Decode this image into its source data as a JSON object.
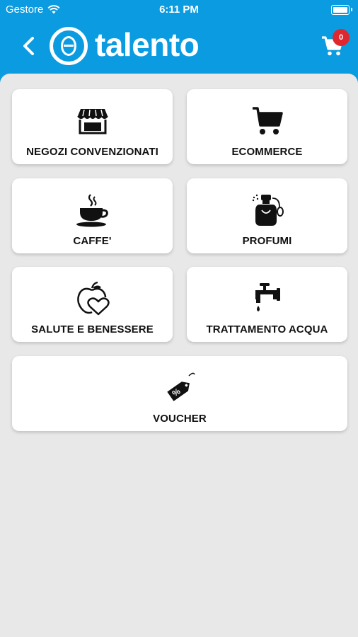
{
  "status": {
    "carrier": "Gestore",
    "time": "6:11 PM"
  },
  "header": {
    "logo_text": "talento",
    "cart_count": "0"
  },
  "colors": {
    "header_bg": "#0b9be0",
    "badge": "#e0262f",
    "background": "#e9e8e8"
  },
  "categories": [
    {
      "label": "NEGOZI CONVENZIONATI",
      "icon": "store-icon"
    },
    {
      "label": "ECOMMERCE",
      "icon": "cart-icon"
    },
    {
      "label": "CAFFE'",
      "icon": "coffee-cup-icon"
    },
    {
      "label": "PROFUMI",
      "icon": "perfume-bottle-icon"
    },
    {
      "label": "SALUTE E BENESSERE",
      "icon": "apple-heart-icon"
    },
    {
      "label": "TRATTAMENTO ACQUA",
      "icon": "water-tap-icon"
    },
    {
      "label": "VOUCHER",
      "icon": "discount-tag-icon"
    }
  ]
}
